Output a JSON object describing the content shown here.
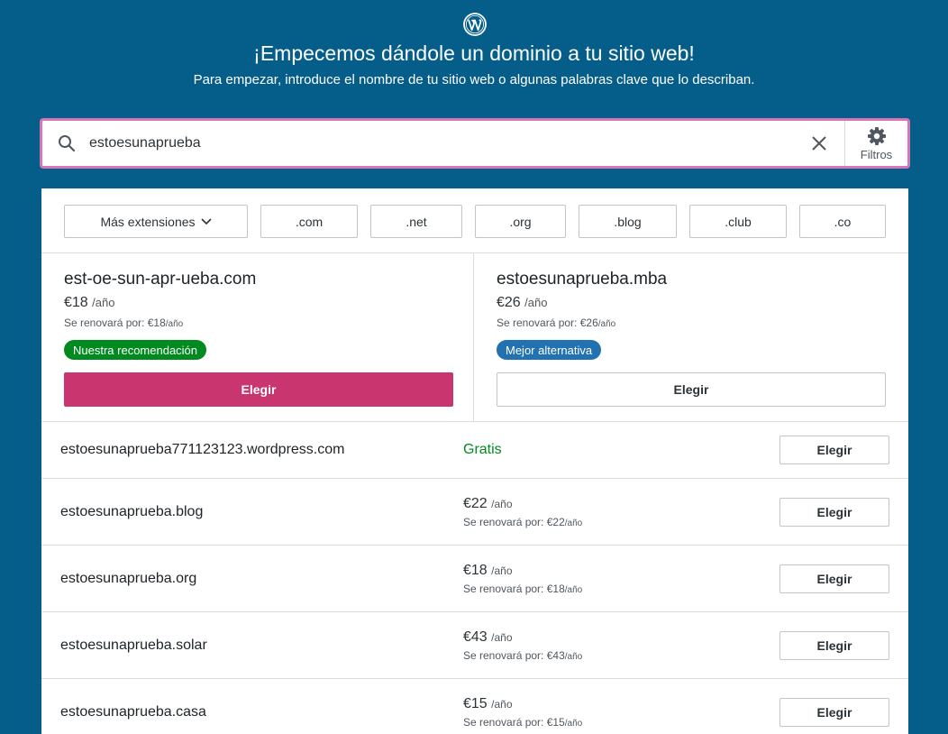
{
  "header": {
    "title": "¡Empecemos dándole un dominio a tu sitio web!",
    "subtitle": "Para empezar, introduce el nombre de tu sitio web o algunas palabras clave que lo describan."
  },
  "search": {
    "value": "estoesunaprueba",
    "filters_label": "Filtros"
  },
  "extensions": {
    "more_label": "Más extensiones",
    "items": [
      ".com",
      ".net",
      ".org",
      ".blog",
      ".club",
      ".co"
    ]
  },
  "featured": [
    {
      "domain": "est-oe-sun-apr-ueba.com",
      "price": "€18",
      "period": "/año",
      "renew_prefix": "Se renovará por: €18",
      "renew_period": "/año",
      "badge": "Nuestra recomendación",
      "choose_label": "Elegir"
    },
    {
      "domain": "estoesunaprueba.mba",
      "price": "€26",
      "period": "/año",
      "renew_prefix": "Se renovará por: €26",
      "renew_period": "/año",
      "badge": "Mejor alternativa",
      "choose_label": "Elegir"
    }
  ],
  "results": [
    {
      "domain": "estoesunaprueba771123123.wordpress.com",
      "free_label": "Gratis",
      "choose_label": "Elegir"
    },
    {
      "domain": "estoesunaprueba.blog",
      "price": "€22",
      "period": "/año",
      "renew_prefix": "Se renovará por: €22",
      "renew_period": "/año",
      "choose_label": "Elegir"
    },
    {
      "domain": "estoesunaprueba.org",
      "price": "€18",
      "period": "/año",
      "renew_prefix": "Se renovará por: €18",
      "renew_period": "/año",
      "choose_label": "Elegir"
    },
    {
      "domain": "estoesunaprueba.solar",
      "price": "€43",
      "period": "/año",
      "renew_prefix": "Se renovará por: €43",
      "renew_period": "/año",
      "choose_label": "Elegir"
    },
    {
      "domain": "estoesunaprueba.casa",
      "price": "€15",
      "period": "/año",
      "renew_prefix": "Se renovará por: €15",
      "renew_period": "/año",
      "choose_label": "Elegir"
    }
  ],
  "colors": {
    "background": "#055d8a",
    "primary": "#c9356e",
    "success": "#008a20",
    "info": "#2271b1",
    "focus_border": "#d974b6"
  },
  "icons": {
    "logo": "wordpress-logo",
    "search": "search-icon",
    "clear": "close-icon",
    "filters": "gear-icon",
    "more": "chevron-down-icon"
  }
}
